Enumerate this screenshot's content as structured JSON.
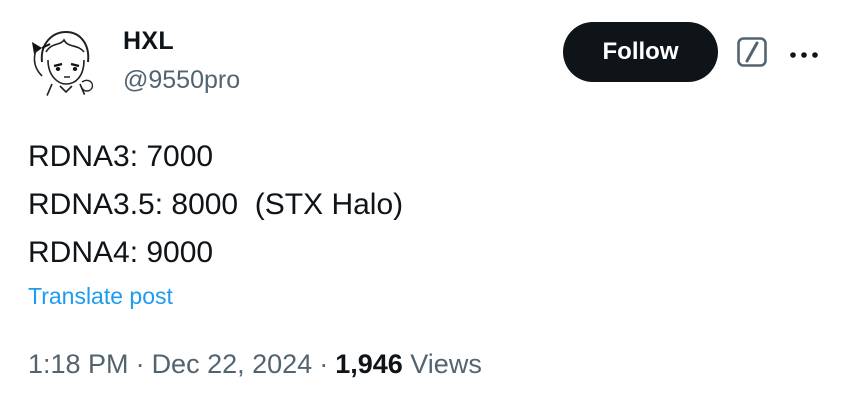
{
  "author": {
    "display_name": "HXL",
    "handle": "@9550pro",
    "avatar_icon": "anime-girl-sketch-avatar"
  },
  "header": {
    "follow_label": "Follow",
    "grok_icon": "grok-icon",
    "more_icon": "more-icon"
  },
  "tweet": {
    "lines": [
      "RDNA3: 7000",
      "RDNA3.5: 8000  (STX Halo)",
      "RDNA4: 9000"
    ],
    "translate_label": "Translate post"
  },
  "meta": {
    "time": "1:18 PM",
    "separator": "·",
    "date": "Dec 22, 2024",
    "views_count": "1,946",
    "views_label": "Views"
  },
  "colors": {
    "text": "#0f1419",
    "secondary": "#536471",
    "link": "#1d9bf0",
    "button_bg": "#0f1419"
  }
}
